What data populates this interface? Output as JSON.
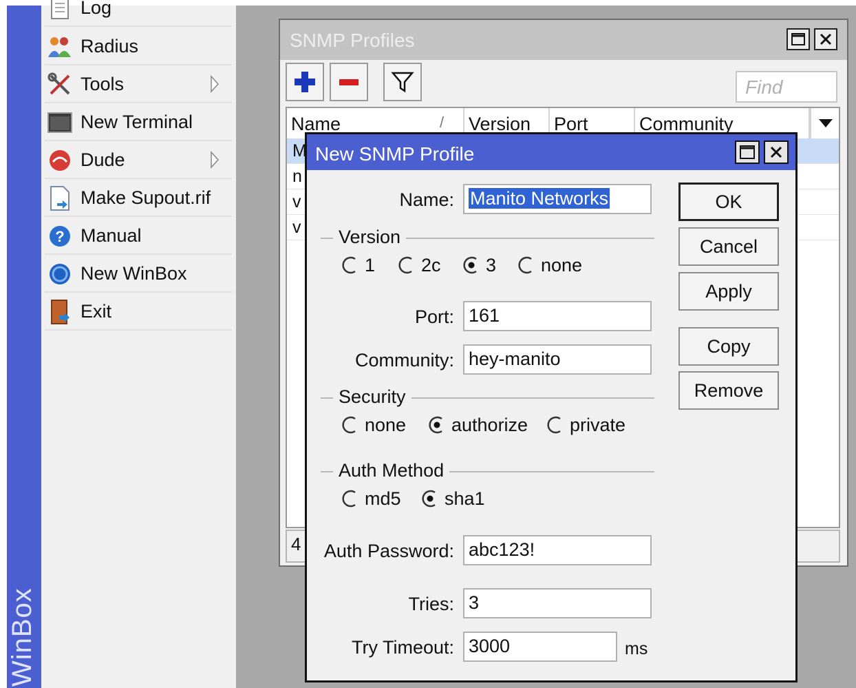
{
  "strip": {
    "label": "WinBox",
    "color": "#4b5fd1"
  },
  "menu": {
    "items": [
      {
        "label": "Log",
        "icon": "log-icon",
        "submenu": false
      },
      {
        "label": "Radius",
        "icon": "radius-users-icon",
        "submenu": false
      },
      {
        "label": "Tools",
        "icon": "tools-icon",
        "submenu": true
      },
      {
        "label": "New Terminal",
        "icon": "terminal-icon",
        "submenu": false
      },
      {
        "label": "Dude",
        "icon": "dude-icon",
        "submenu": true
      },
      {
        "label": "Make Supout.rif",
        "icon": "supout-file-icon",
        "submenu": false
      },
      {
        "label": "Manual",
        "icon": "help-icon",
        "submenu": false
      },
      {
        "label": "New WinBox",
        "icon": "winbox-globe-icon",
        "submenu": false
      },
      {
        "label": "Exit",
        "icon": "exit-door-icon",
        "submenu": false
      }
    ]
  },
  "profiles_window": {
    "title": "SNMP Profiles",
    "find_placeholder": "Find",
    "columns": [
      "Name",
      "Version",
      "Port",
      "Community"
    ],
    "rows": [
      {
        "name": "M"
      },
      {
        "name": "n"
      },
      {
        "name": "v"
      },
      {
        "name": "v"
      }
    ],
    "status_text": "4"
  },
  "dialog": {
    "title": "New SNMP Profile",
    "name_label": "Name:",
    "name_value": "Manito Networks",
    "version_group": "Version",
    "version_options": [
      "1",
      "2c",
      "3",
      "none"
    ],
    "version_selected": "3",
    "port_label": "Port:",
    "port_value": "161",
    "community_label": "Community:",
    "community_value": "hey-manito",
    "security_group": "Security",
    "security_options": [
      "none",
      "authorize",
      "private"
    ],
    "security_selected": "authorize",
    "auth_group": "Auth Method",
    "auth_options": [
      "md5",
      "sha1"
    ],
    "auth_selected": "sha1",
    "auth_password_label": "Auth Password:",
    "auth_password_value": "abc123!",
    "tries_label": "Tries:",
    "tries_value": "3",
    "timeout_label": "Try Timeout:",
    "timeout_value": "3000",
    "timeout_unit": "ms",
    "buttons": {
      "ok": "OK",
      "cancel": "Cancel",
      "apply": "Apply",
      "copy": "Copy",
      "remove": "Remove"
    }
  },
  "colors": {
    "title_active": "#4b5fd1",
    "title_inactive": "#c3c3c3",
    "selection": "#2f62d2",
    "desktop": "#a8a8a8"
  }
}
